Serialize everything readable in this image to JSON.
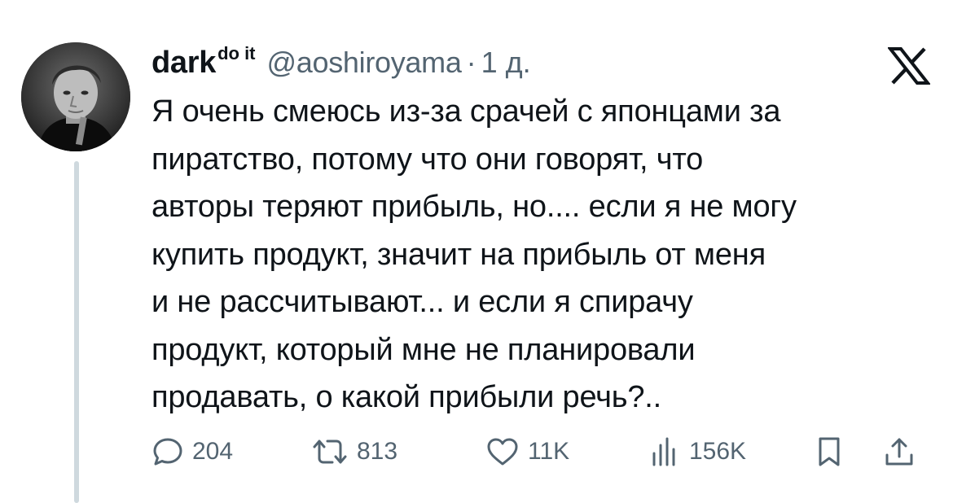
{
  "tweet": {
    "author": {
      "display_name": "dark",
      "display_name_sup": "do it",
      "handle": "@aoshiroyama",
      "separator": "·",
      "time": "1 д.",
      "avatar": "avatar-photo-icon"
    },
    "platform_logo": "x-logo-icon",
    "text_lines": [
      "Я очень смеюсь из-за срачей с японцами за",
      "пиратство, потому что они говорят, что",
      "авторы теряют прибыль, но.... если я не могу",
      "купить продукт, значит на прибыль от меня",
      "и не рассчитывают... и если я спирачу",
      "продукт, который мне не планировали",
      "продавать, о какой прибыли речь?.."
    ],
    "actions": {
      "replies": {
        "count": "204",
        "icon": "reply-icon"
      },
      "reposts": {
        "count": "813",
        "icon": "repost-icon"
      },
      "likes": {
        "count": "11K",
        "icon": "like-icon"
      },
      "views": {
        "count": "156K",
        "icon": "views-icon"
      },
      "bookmark": {
        "icon": "bookmark-icon"
      },
      "share": {
        "icon": "share-icon"
      }
    }
  },
  "colors": {
    "text_primary": "#0f1419",
    "text_secondary": "#536471",
    "thread_line": "#cfd9de",
    "background": "#ffffff"
  }
}
